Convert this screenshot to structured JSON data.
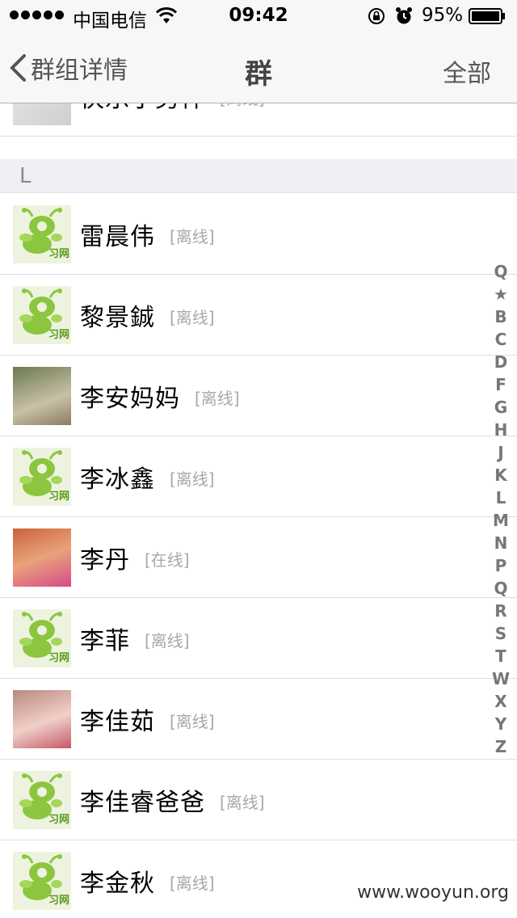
{
  "status_bar": {
    "carrier": "中国电信",
    "time": "09:42",
    "battery": "95%"
  },
  "nav": {
    "back_label": "群组详情",
    "title": "群",
    "right_label": "全部"
  },
  "section": "L",
  "rows": [
    {
      "name": "快乐小男神",
      "status": "[离线]",
      "avatar": "photo"
    },
    {
      "name": "雷晨伟",
      "status": "[离线]",
      "avatar": "logo"
    },
    {
      "name": "黎景鋮",
      "status": "[离线]",
      "avatar": "logo"
    },
    {
      "name": "李安妈妈",
      "status": "[离线]",
      "avatar": "photo"
    },
    {
      "name": "李冰鑫",
      "status": "[离线]",
      "avatar": "logo"
    },
    {
      "name": "李丹",
      "status": "[在线]",
      "avatar": "photo"
    },
    {
      "name": "李菲",
      "status": "[离线]",
      "avatar": "logo"
    },
    {
      "name": "李佳茹",
      "status": "[离线]",
      "avatar": "photo"
    },
    {
      "name": "李佳睿爸爸",
      "status": "[离线]",
      "avatar": "logo"
    },
    {
      "name": "李金秋",
      "status": "[离线]",
      "avatar": "logo"
    }
  ],
  "logo_text": "习网",
  "index_letters": [
    "Q",
    "★",
    "B",
    "C",
    "D",
    "F",
    "G",
    "H",
    "J",
    "K",
    "L",
    "M",
    "N",
    "P",
    "Q",
    "R",
    "S",
    "T",
    "W",
    "X",
    "Y",
    "Z"
  ],
  "watermark": "www.wooyun.org",
  "colors": {
    "bar_bg": "#f7f7f8",
    "section_bg": "#efeff4",
    "logo_green": "#8cc63f",
    "status_gray": "#a8a8a8"
  }
}
